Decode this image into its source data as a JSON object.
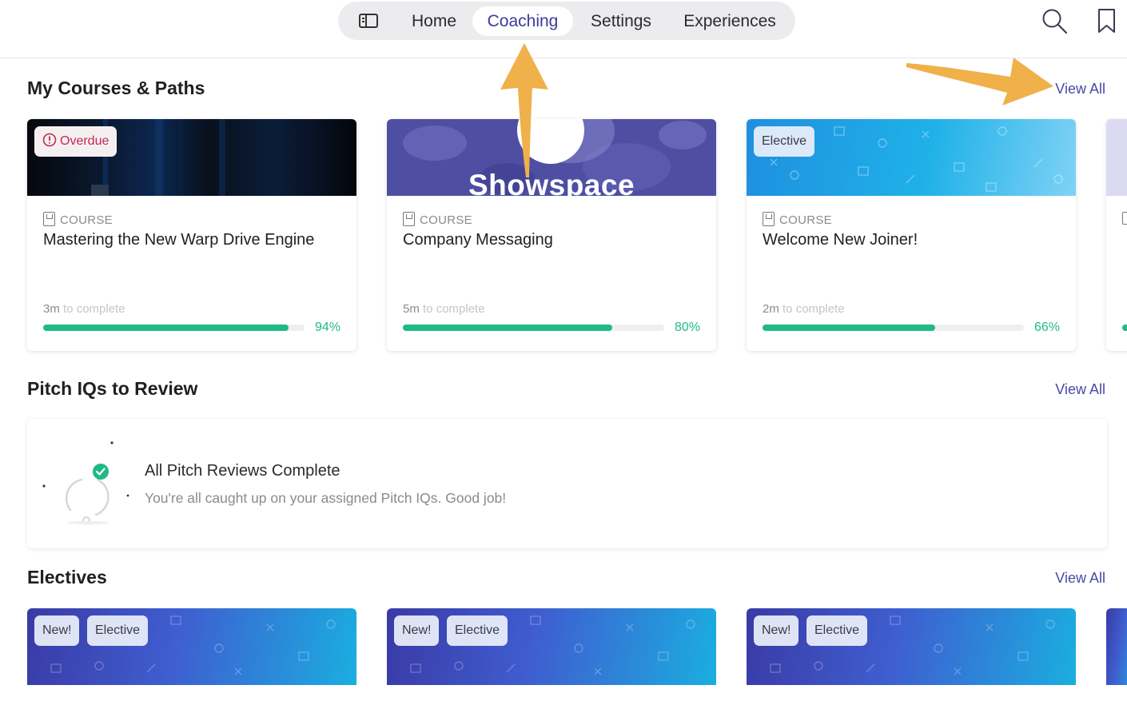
{
  "nav": {
    "items": [
      {
        "label": "Home",
        "active": false
      },
      {
        "label": "Coaching",
        "active": true
      },
      {
        "label": "Settings",
        "active": false
      },
      {
        "label": "Experiences",
        "active": false
      }
    ],
    "icons": [
      "sidebar-toggle-icon",
      "search-icon",
      "bookmark-icon"
    ]
  },
  "courses": {
    "title": "My Courses & Paths",
    "view_all": "View All",
    "items": [
      {
        "badge": "Overdue",
        "type": "COURSE",
        "title": "Mastering the New Warp Drive Engine",
        "time_value": "3m",
        "time_suffix": "to complete",
        "progress": 94,
        "progress_label": "94%"
      },
      {
        "image_text": "Showspace",
        "type": "COURSE",
        "title": "Company Messaging",
        "time_value": "5m",
        "time_suffix": "to complete",
        "progress": 80,
        "progress_label": "80%"
      },
      {
        "badge": "Elective",
        "type": "COURSE",
        "title": "Welcome New Joiner!",
        "time_value": "2m",
        "time_suffix": "to complete",
        "progress": 66,
        "progress_label": "66%"
      }
    ]
  },
  "pitch": {
    "title": "Pitch IQs to Review",
    "view_all": "View All",
    "empty_title": "All Pitch Reviews Complete",
    "empty_subtitle": "You're all caught up on your assigned Pitch IQs. Good job!"
  },
  "electives": {
    "title": "Electives",
    "view_all": "View All",
    "items": [
      {
        "badge_new": "New!",
        "badge_type": "Elective"
      },
      {
        "badge_new": "New!",
        "badge_type": "Elective"
      },
      {
        "badge_new": "New!",
        "badge_type": "Elective"
      }
    ]
  },
  "colors": {
    "accent": "#4b48a6",
    "progress": "#1fba86",
    "overdue": "#c62650",
    "annotation_arrow": "#f0b04a"
  }
}
